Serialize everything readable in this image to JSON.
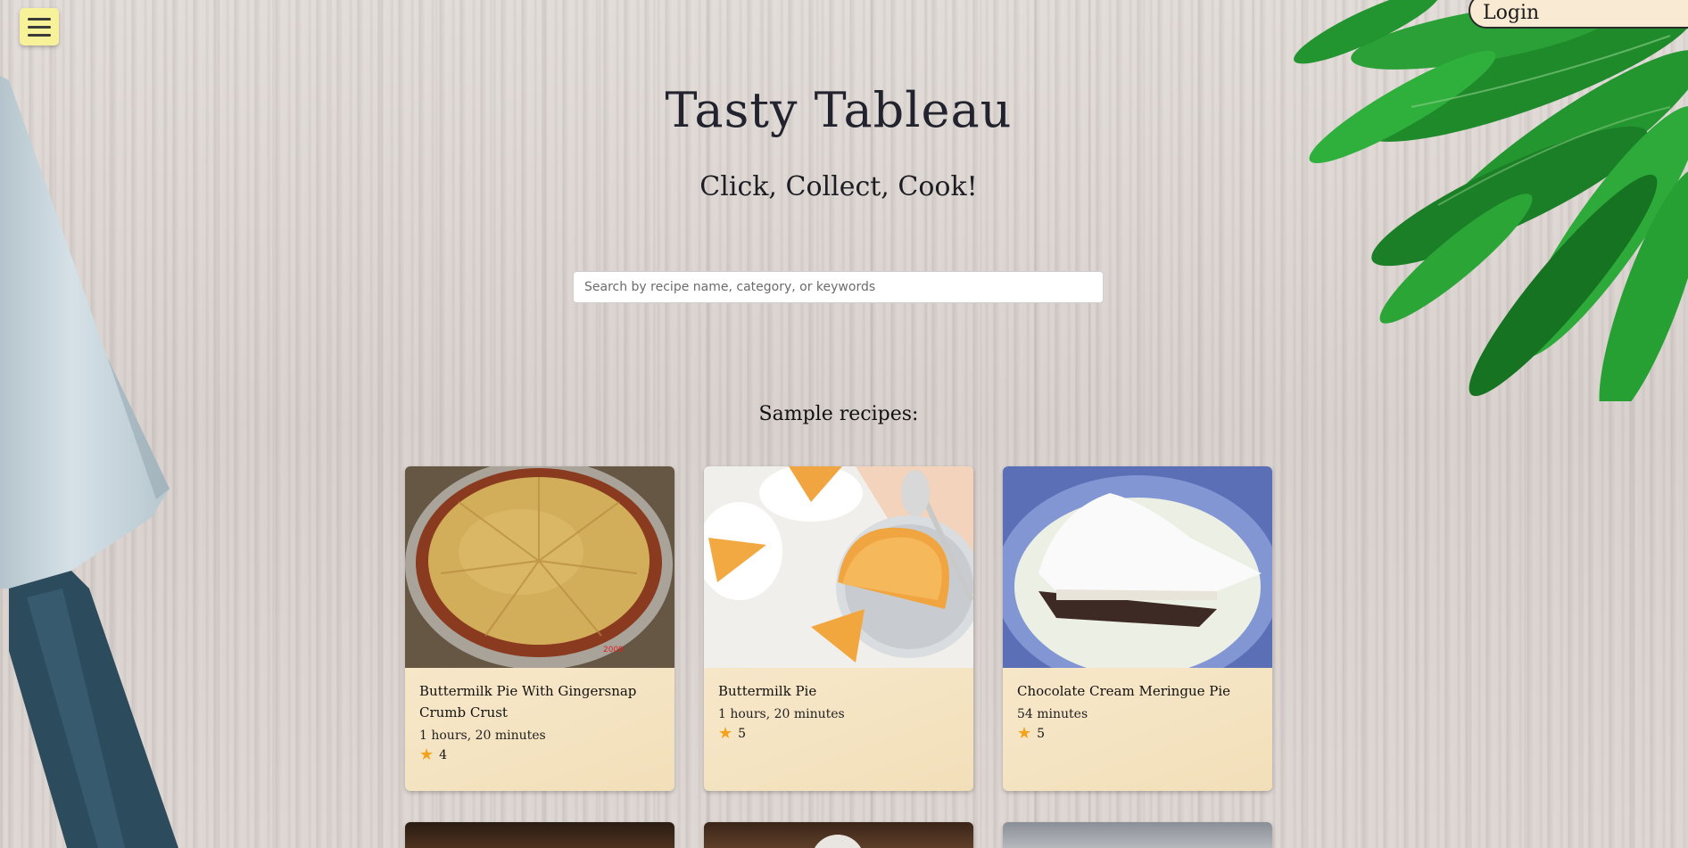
{
  "header": {
    "menu_icon": "hamburger-menu-icon",
    "login_label": "Login"
  },
  "hero": {
    "title": "Tasty Tableau",
    "tagline": "Click, Collect, Cook!"
  },
  "search": {
    "placeholder": "Search by recipe name, category, or keywords",
    "value": ""
  },
  "sample": {
    "heading": "Sample recipes:",
    "recipes": [
      {
        "title": "Buttermilk Pie With Gingersnap Crumb Crust",
        "time": "1 hours, 20 minutes",
        "rating": "4"
      },
      {
        "title": "Buttermilk Pie",
        "time": "1 hours, 20 minutes",
        "rating": "5"
      },
      {
        "title": "Chocolate Cream Meringue Pie",
        "time": "54 minutes",
        "rating": "5"
      }
    ]
  },
  "colors": {
    "menu_button": "#f7f19a",
    "login_button": "#f8ead3",
    "card_background": "#f6e6c6",
    "star": "#f3a21b"
  }
}
